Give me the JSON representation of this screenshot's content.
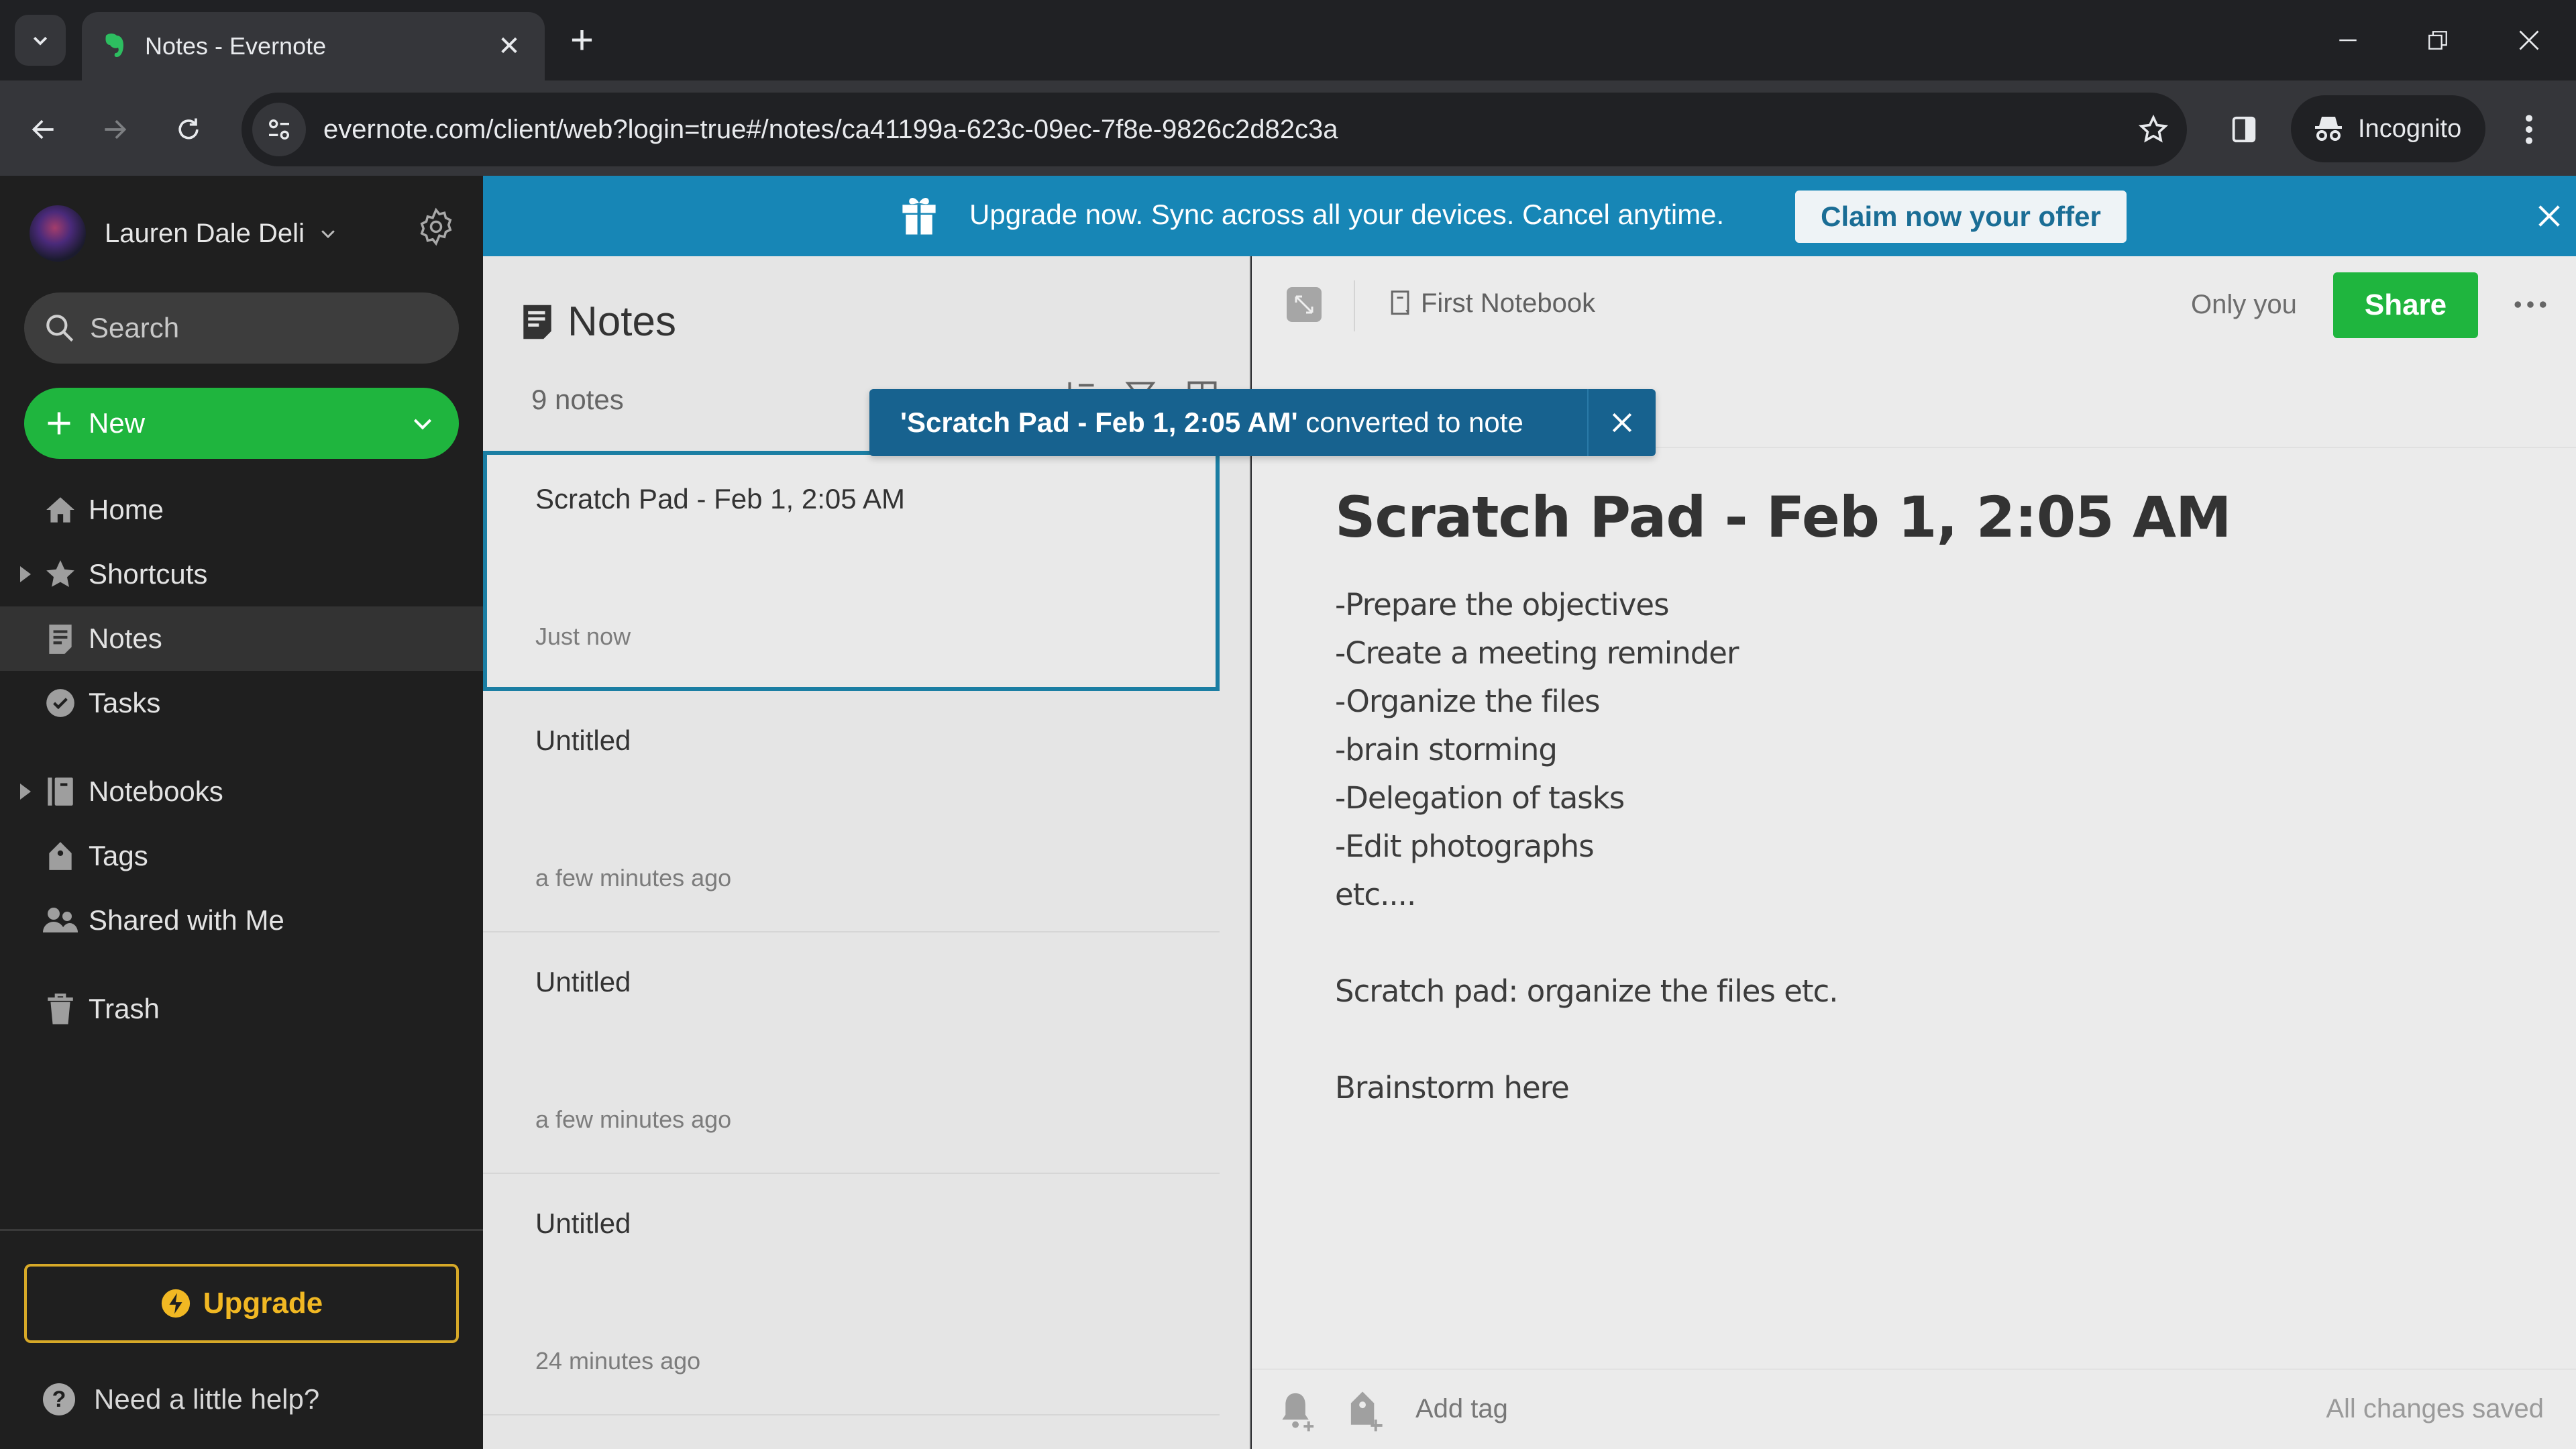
{
  "browser": {
    "tab_title": "Notes - Evernote",
    "url": "evernote.com/client/web?login=true#/notes/ca41199a-623c-09ec-7f8e-9826c2d82c3a",
    "incognito_label": "Incognito"
  },
  "colors": {
    "evernote_green": "#1fb53e",
    "banner_blue": "#1786b6",
    "toast_blue": "#17628f",
    "upgrade_gold": "#f1b823",
    "selection_border": "#1b7ea3"
  },
  "sidebar": {
    "account_name": "Lauren Dale Deli",
    "search_placeholder": "Search",
    "new_label": "New",
    "items": [
      {
        "label": "Home",
        "icon": "home-icon"
      },
      {
        "label": "Shortcuts",
        "icon": "star-icon",
        "expandable": true
      },
      {
        "label": "Notes",
        "icon": "notes-icon",
        "active": true
      },
      {
        "label": "Tasks",
        "icon": "check-circle-icon"
      },
      {
        "label": "Notebooks",
        "icon": "notebook-icon",
        "expandable": true
      },
      {
        "label": "Tags",
        "icon": "tag-icon"
      },
      {
        "label": "Shared with Me",
        "icon": "people-icon"
      },
      {
        "label": "Trash",
        "icon": "trash-icon"
      }
    ],
    "upgrade_label": "Upgrade",
    "help_label": "Need a little help?"
  },
  "promo": {
    "text": "Upgrade now. Sync across all your devices. Cancel anytime.",
    "claim_label": "Claim now your offer"
  },
  "toast": {
    "note_name": "'Scratch Pad - Feb 1, 2:05 AM'",
    "suffix": " converted to note"
  },
  "note_list": {
    "title": "Notes",
    "count": "9 notes",
    "notes": [
      {
        "title": "Scratch Pad - Feb 1, 2:05 AM",
        "time": "Just now",
        "selected": true
      },
      {
        "title": "Untitled",
        "time": "a few minutes ago"
      },
      {
        "title": "Untitled",
        "time": "a few minutes ago"
      },
      {
        "title": "Untitled",
        "time": "24 minutes ago"
      }
    ]
  },
  "editor": {
    "notebook": "First Notebook",
    "visibility": "Only you",
    "share_label": "Share",
    "title": "Scratch Pad - Feb 1, 2:05 AM",
    "lines": [
      "-Prepare the objectives",
      "-Create a meeting reminder",
      "-Organize the files",
      "-brain storming",
      "-Delegation of tasks",
      "-Edit photographs",
      "etc....",
      "",
      "Scratch pad: organize the files etc.",
      "",
      "Brainstorm here"
    ],
    "add_tag_label": "Add tag",
    "save_status": "All changes saved"
  }
}
